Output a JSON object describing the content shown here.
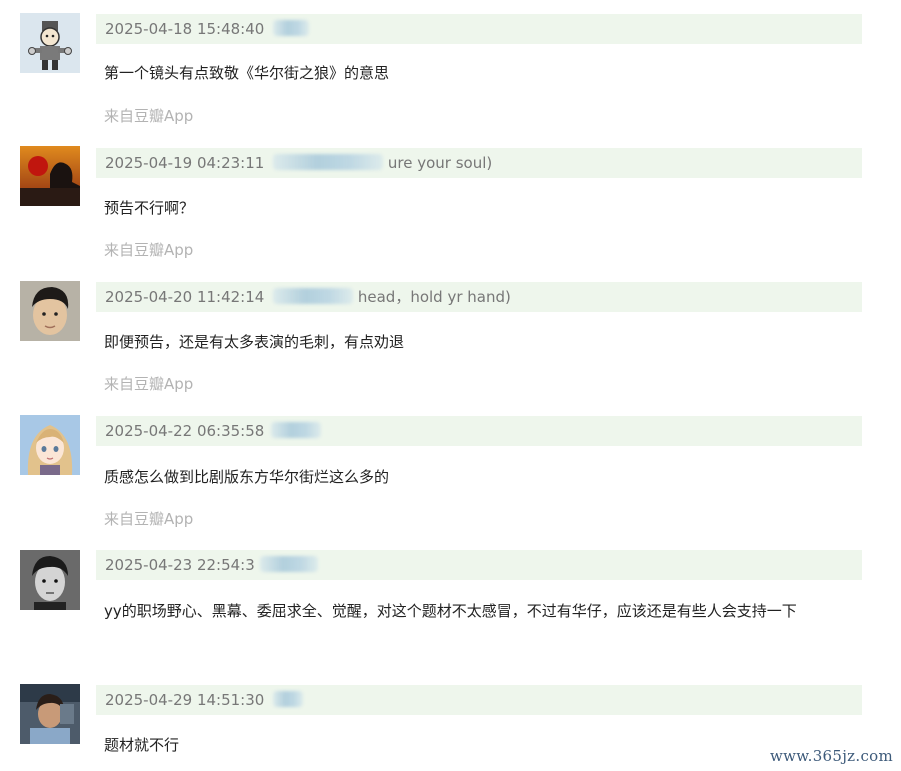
{
  "comments": [
    {
      "timestamp": "2025-04-18 15:48:40",
      "user_fragment_before": "",
      "user_fragment_after": "",
      "text": "第一个镜头有点致敬《华尔街之狼》的意思",
      "source": "来自豆瓣App"
    },
    {
      "timestamp": "2025-04-19 04:23:11",
      "user_fragment_before": "",
      "user_fragment_after": "ure your soul)",
      "text": "预告不行啊？",
      "source": "来自豆瓣App"
    },
    {
      "timestamp": "2025-04-20 11:42:14",
      "user_fragment_before": "",
      "user_fragment_after": "head，hold yr hand)",
      "text": "即便预告，还是有太多表演的毛刺，有点劝退",
      "source": "来自豆瓣App"
    },
    {
      "timestamp": "2025-04-22 06:35:58",
      "user_fragment_before": "",
      "user_fragment_after": "",
      "text": "质感怎么做到比剧版东方华尔街烂这么多的",
      "source": "来自豆瓣App"
    },
    {
      "timestamp": "2025-04-23 22:54:3",
      "user_fragment_before": "",
      "user_fragment_after": "",
      "text": "yy的职场野心、黑幕、委屈求全、觉醒，对这个题材不太感冒，不过有华仔，应该还是有些人会支持一下",
      "source": ""
    },
    {
      "timestamp": "2025-04-29 14:51:30",
      "user_fragment_before": "",
      "user_fragment_after": "",
      "text": "题材就不行",
      "source": ""
    }
  ],
  "watermark": "www.365jz.com",
  "icons": [
    "avatar-pharaoh",
    "avatar-sunset",
    "avatar-man",
    "avatar-anime-girl",
    "avatar-bw-portrait",
    "avatar-photo"
  ]
}
